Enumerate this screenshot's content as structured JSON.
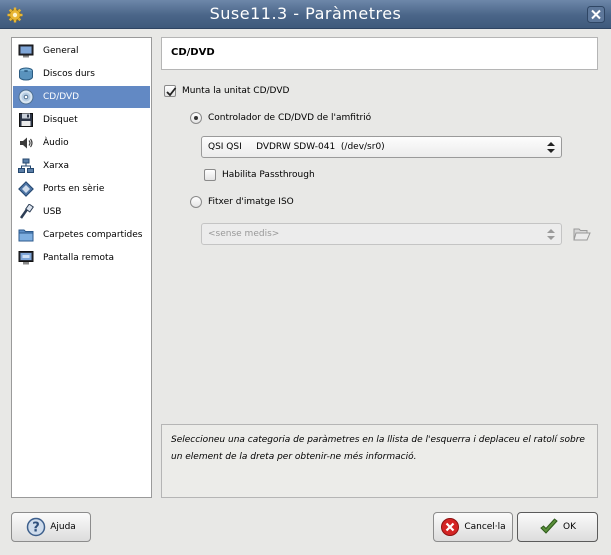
{
  "window": {
    "title": "Suse11.3 - Paràmetres"
  },
  "sidebar": {
    "items": [
      {
        "label": "General",
        "icon": "monitor-icon"
      },
      {
        "label": "Discos durs",
        "icon": "hard-disk-icon"
      },
      {
        "label": "CD/DVD",
        "icon": "cd-dvd-icon",
        "selected": true
      },
      {
        "label": "Disquet",
        "icon": "floppy-icon"
      },
      {
        "label": "Àudio",
        "icon": "audio-icon"
      },
      {
        "label": "Xarxa",
        "icon": "network-icon"
      },
      {
        "label": "Ports en sèrie",
        "icon": "serial-port-icon"
      },
      {
        "label": "USB",
        "icon": "usb-icon"
      },
      {
        "label": "Carpetes compartides",
        "icon": "folder-icon"
      },
      {
        "label": "Pantalla remota",
        "icon": "remote-display-icon"
      }
    ]
  },
  "page": {
    "header": "CD/DVD"
  },
  "cd": {
    "mount_label": "Munta la unitat CD/DVD",
    "mount_checked": true,
    "host_drive_label": "Controlador de CD/DVD de l'amfitrió",
    "host_drive_selected": true,
    "host_drive_value": "QSI QSI     DVDRW SDW-041  (/dev/sr0)",
    "passthrough_label": "Habilita Passthrough",
    "passthrough_checked": false,
    "iso_label": "Fitxer d'imatge ISO",
    "iso_selected": false,
    "iso_value": "<sense medis>"
  },
  "info": {
    "text": "Seleccioneu una categoria de paràmetres en la llista de l'esquerra i deplaceu el ratolí sobre un element de la dreta per obtenir-ne més informació."
  },
  "buttons": {
    "help": "Ajuda",
    "cancel": "Cancel·la",
    "ok": "OK"
  },
  "colors": {
    "titlebar": "#4a6588",
    "selection": "#6289c4"
  }
}
